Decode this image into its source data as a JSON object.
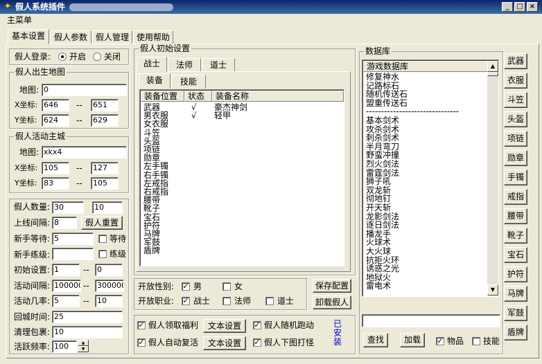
{
  "window": {
    "title": "假人系统插件",
    "minimize": "_",
    "maximize": "□",
    "close": "×"
  },
  "menu": {
    "main": "主菜单"
  },
  "tabs": [
    "基本设置",
    "假人参数",
    "假人管理",
    "使用帮助"
  ],
  "login": {
    "label": "假人登录:",
    "on": "开启",
    "off": "关闭"
  },
  "birth": {
    "title": "假人出生地图",
    "map_label": "地图:",
    "map": "0",
    "x_label": "X坐标:",
    "x_from": "646",
    "x_to": "651",
    "y_label": "Y坐标:",
    "y_from": "624",
    "y_to": "629",
    "sep": "--"
  },
  "city": {
    "title": "假人活动主城",
    "map_label": "地图:",
    "map": "xkx4",
    "x_label": "X坐标:",
    "x_from": "105",
    "x_to": "127",
    "y_label": "Y坐标:",
    "y_from": "83",
    "y_to": "105",
    "sep": "--"
  },
  "params": {
    "count_label": "假人数量:",
    "count_a": "30",
    "count_b": "10",
    "interval_label": "上线间隔:",
    "interval": "8",
    "reset_btn": "假人重置",
    "wait_label": "新手等待:",
    "wait": "5",
    "wait_chk": "等待",
    "level_label": "新手练级:",
    "level": "",
    "level_chk": "练级",
    "init_label": "初始设置:",
    "init_a": "1",
    "init_b": "0",
    "act_interval_label": "活动间隔:",
    "act_a": "100000",
    "act_b": "300000",
    "act_rate_label": "活动几率:",
    "rate_a": "5",
    "rate_b": "10",
    "return_label": "回城时间:",
    "return_val": "25",
    "clear_label": "清理包裹:",
    "clear_val": "10",
    "freq_label": "活跃频率:",
    "freq_val": "100",
    "sep": "--"
  },
  "init": {
    "title": "假人初始设置",
    "classes": [
      "战士",
      "法师",
      "道士"
    ],
    "subtabs": [
      "装备",
      "技能"
    ],
    "columns": [
      "装备位置",
      "状态",
      "装备名称"
    ],
    "rows": [
      {
        "pos": "武器",
        "status": "√",
        "name": "豪杰神剑"
      },
      {
        "pos": "男衣服",
        "status": "√",
        "name": "轻甲"
      },
      {
        "pos": "女衣服",
        "status": "",
        "name": ""
      },
      {
        "pos": "斗笠",
        "status": "",
        "name": ""
      },
      {
        "pos": "头盔",
        "status": "",
        "name": ""
      },
      {
        "pos": "项链",
        "status": "",
        "name": ""
      },
      {
        "pos": "勋章",
        "status": "",
        "name": ""
      },
      {
        "pos": "左手镯",
        "status": "",
        "name": ""
      },
      {
        "pos": "右手镯",
        "status": "",
        "name": ""
      },
      {
        "pos": "左戒指",
        "status": "",
        "name": ""
      },
      {
        "pos": "右戒指",
        "status": "",
        "name": ""
      },
      {
        "pos": "腰带",
        "status": "",
        "name": ""
      },
      {
        "pos": "靴子",
        "status": "",
        "name": ""
      },
      {
        "pos": "宝石",
        "status": "",
        "name": ""
      },
      {
        "pos": "护符",
        "status": "",
        "name": ""
      },
      {
        "pos": "马牌",
        "status": "",
        "name": ""
      },
      {
        "pos": "军鼓",
        "status": "",
        "name": ""
      },
      {
        "pos": "盾牌",
        "status": "",
        "name": ""
      }
    ]
  },
  "open": {
    "gender_label": "开放性别:",
    "male": "男",
    "female": "女",
    "job_label": "开放职业:",
    "warrior": "战士",
    "mage": "法师",
    "taoist": "道士",
    "save_btn": "保存配置",
    "unload_btn": "卸载假人"
  },
  "opts": {
    "welfare": "假人领取福利",
    "text_btn1": "文本设置",
    "run": "假人随机跑动",
    "revive": "假人自动复活",
    "text_btn2": "文本设置",
    "hang": "假人下图打怪",
    "installed": "已安装"
  },
  "db": {
    "title": "数据库",
    "header": "游戏数据库",
    "items": [
      "修复神水",
      "记路标石",
      "随机传送石",
      "盟重传送石",
      "-------------------------------",
      "基本剑术",
      "攻杀剑术",
      "刺杀剑术",
      "半月弯刀",
      "野蛮冲撞",
      "烈火剑法",
      "雷霆剑法",
      "狮子吼",
      "双龙斩",
      "彻地钉",
      "开天斩",
      "龙影剑法",
      "逐日剑法",
      "播龙手",
      "火球术",
      "大火球",
      "抗拒火环",
      "诱惑之光",
      "地狱火",
      "雷电术"
    ],
    "search_btn": "查找",
    "load_btn": "加载",
    "item_chk": "物品",
    "skill_chk": "技能",
    "side": [
      "武器",
      "衣服",
      "斗笠",
      "头盔",
      "项链",
      "勋章",
      "手镯",
      "戒指",
      "腰带",
      "靴子",
      "宝石",
      "护符",
      "马牌",
      "军鼓",
      "盾牌"
    ]
  }
}
